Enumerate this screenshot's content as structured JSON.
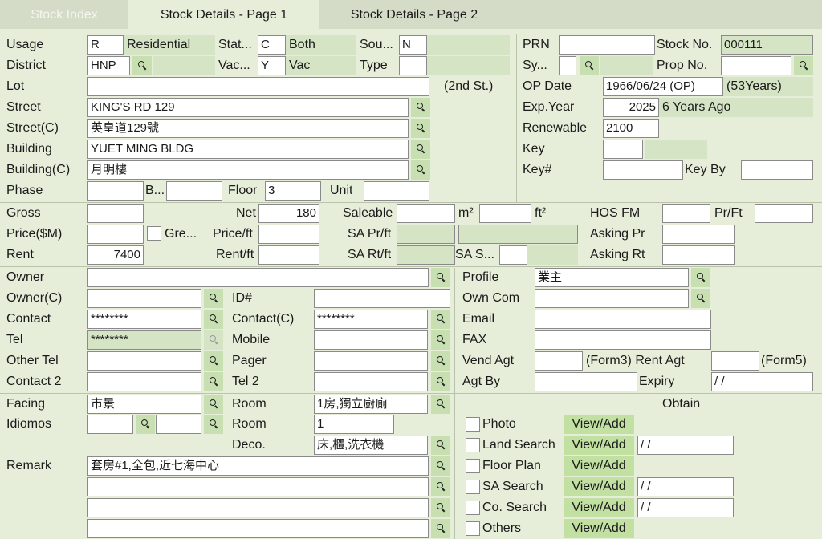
{
  "tabs": {
    "t1": "Stock Index",
    "t2": "Stock Details - Page 1",
    "t3": "Stock Details - Page 2"
  },
  "labels": {
    "usage": "Usage",
    "stat": "Stat...",
    "sou": "Sou...",
    "prn": "PRN",
    "stockno": "Stock No.",
    "district": "District",
    "vac": "Vac...",
    "type": "Type",
    "sy": "Sy...",
    "propno": "Prop No.",
    "lot": "Lot",
    "secondst": "(2nd St.)",
    "opdate": "OP Date",
    "street": "Street",
    "expyear": "Exp.Year",
    "streetc": "Street(C)",
    "renewable": "Renewable",
    "building": "Building",
    "key": "Key",
    "buildingc": "Building(C)",
    "keyno": "Key#",
    "keyby": "Key By",
    "phase": "Phase",
    "b": "B...",
    "floor": "Floor",
    "unit": "Unit",
    "gross": "Gross",
    "net": "Net",
    "saleable": "Saleable",
    "m2": "m²",
    "ft2": "ft²",
    "hosfm": "HOS FM",
    "prft": "Pr/Ft",
    "price": "Price($M)",
    "gre": "Gre...",
    "priceft": "Price/ft",
    "saprft": "SA Pr/ft",
    "askingpr": "Asking Pr",
    "rent": "Rent",
    "rentft": "Rent/ft",
    "sartft": "SA Rt/ft",
    "sas": "SA S...",
    "askingrt": "Asking Rt",
    "owner": "Owner",
    "profile": "Profile",
    "ownerc": "Owner(C)",
    "idno": "ID#",
    "owncom": "Own Com",
    "contact": "Contact",
    "contactc": "Contact(C)",
    "email": "Email",
    "tel": "Tel",
    "mobile": "Mobile",
    "fax": "FAX",
    "othertel": "Other Tel",
    "pager": "Pager",
    "vendagt": "Vend Agt",
    "form3": "(Form3) Rent Agt",
    "form5": "(Form5)",
    "contact2": "Contact 2",
    "tel2": "Tel 2",
    "agtby": "Agt By",
    "expiry": "Expiry",
    "facing": "Facing",
    "room": "Room",
    "obtain": "Obtain",
    "idiomos": "Idiomos",
    "room2": "Room",
    "deco": "Deco.",
    "remark": "Remark",
    "photo": "Photo",
    "landsearch": "Land Search",
    "floorplan": "Floor Plan",
    "sasearch": "SA Search",
    "cosearch": "Co. Search",
    "others": "Others"
  },
  "values": {
    "usage": "R",
    "usage_desc": "Residential",
    "stat": "C",
    "stat_desc": "Both",
    "sou": "N",
    "stockno": "000111",
    "district": "HNP",
    "vac": "Y",
    "vac_desc": "Vac",
    "opdate": "1966/06/24 (OP)",
    "years": "(53Years)",
    "street": "KING'S RD 129",
    "expyear": "2025",
    "expyear_desc": "6 Years Ago",
    "streetc": "英皇道129號",
    "renewable": "2100",
    "building": "YUET MING BLDG",
    "buildingc": "月明樓",
    "floor": "3",
    "net": "180",
    "rent": "7400",
    "contact": "********",
    "contactc": "********",
    "tel": "********",
    "profile": "業主",
    "facing": "市景",
    "room": "1房,獨立廚廁",
    "room2": "1",
    "deco": "床,櫃,洗衣機",
    "remark1": "套房#1,全包,近七海中心",
    "expiry": " / /",
    "landsearch_date": " / /",
    "sasearch_date": " / /",
    "cosearch_date": " / /"
  },
  "buttons": {
    "viewadd": "View/Add"
  }
}
